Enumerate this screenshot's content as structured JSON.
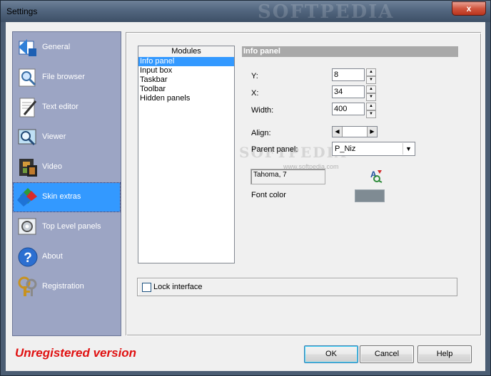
{
  "window": {
    "title": "Settings",
    "close_glyph": "x",
    "watermark": "SOFTPEDIA"
  },
  "sidebar": {
    "items": [
      {
        "label": "General",
        "icon": "general-icon",
        "active": false
      },
      {
        "label": "File browser",
        "icon": "file-browser-icon",
        "active": false
      },
      {
        "label": "Text editor",
        "icon": "text-editor-icon",
        "active": false
      },
      {
        "label": "Viewer",
        "icon": "viewer-icon",
        "active": false
      },
      {
        "label": "Video",
        "icon": "video-icon",
        "active": false
      },
      {
        "label": "Skin extras",
        "icon": "skin-extras-icon",
        "active": true
      },
      {
        "label": "Top Level panels",
        "icon": "top-level-panels-icon",
        "active": false
      },
      {
        "label": "About",
        "icon": "about-icon",
        "active": false
      },
      {
        "label": "Registration",
        "icon": "registration-icon",
        "active": false
      }
    ]
  },
  "modules": {
    "header": "Modules",
    "items": [
      "Info panel",
      "Input box",
      "Taskbar",
      "Toolbar",
      "Hidden panels"
    ],
    "selected": "Info panel"
  },
  "panel": {
    "title": "Info panel",
    "y_label": "Y:",
    "y_value": "8",
    "x_label": "X:",
    "x_value": "34",
    "width_label": "Width:",
    "width_value": "400",
    "align_label": "Align:",
    "parent_label": "Parent panel:",
    "parent_value": "P_Niz",
    "font_value": "Tahoma, 7",
    "font_color_label": "Font color",
    "font_color": "#7f8b93",
    "watermark": "SOFTPEDIA",
    "watermark_url": "www.softpedia.com"
  },
  "lock": {
    "label": "Lock interface",
    "checked": false
  },
  "footer": {
    "status": "Unregistered version",
    "ok": "OK",
    "cancel": "Cancel",
    "help": "Help"
  },
  "colors": {
    "selection": "#3399ff",
    "sidebar": "#9ca5c4",
    "status_red": "#e01010"
  }
}
